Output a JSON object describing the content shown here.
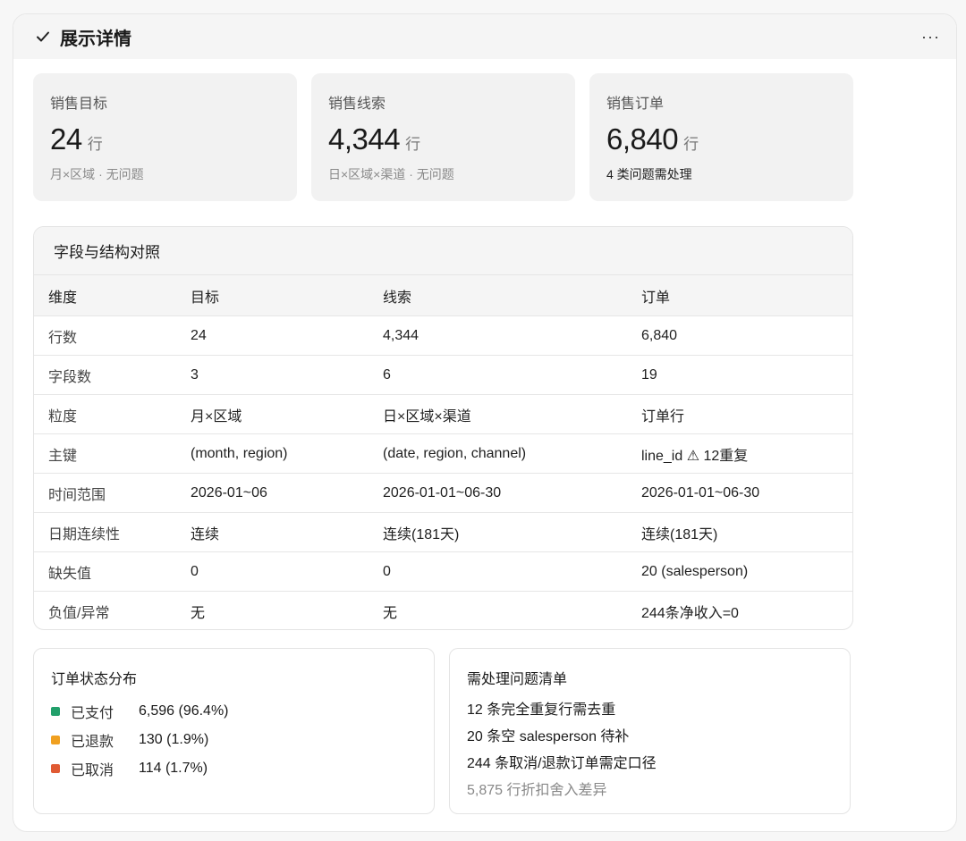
{
  "header": {
    "title": "展示详情",
    "check_icon": "check-icon",
    "more_icon": "more-horizontal-icon",
    "more_label": "···"
  },
  "cards": [
    {
      "label": "销售目标",
      "value": "24",
      "unit": "行",
      "note": "月×区域 · 无问题",
      "warn": false
    },
    {
      "label": "销售线索",
      "value": "4,344",
      "unit": "行",
      "note": "日×区域×渠道 · 无问题",
      "warn": false
    },
    {
      "label": "销售订单",
      "value": "6,840",
      "unit": "行",
      "note": "4 类问题需处理",
      "warn": true
    }
  ],
  "comparison": {
    "title": "字段与结构对照",
    "headers": [
      "维度",
      "目标",
      "线索",
      "订单"
    ],
    "rows": [
      [
        "行数",
        "24",
        "4,344",
        "6,840"
      ],
      [
        "字段数",
        "3",
        "6",
        "19"
      ],
      [
        "粒度",
        "月×区域",
        "日×区域×渠道",
        "订单行"
      ],
      [
        "主键",
        "(month, region)",
        "(date, region, channel)",
        "line_id ⚠ 12重复"
      ],
      [
        "时间范围",
        "2026-01~06",
        "2026-01-01~06-30",
        "2026-01-01~06-30"
      ],
      [
        "日期连续性",
        "连续",
        "连续(181天)",
        "连续(181天)"
      ],
      [
        "缺失值",
        "0",
        "0",
        "20 (salesperson)"
      ],
      [
        "负值/异常",
        "无",
        "无",
        "244条净收入=0"
      ]
    ]
  },
  "order_status": {
    "title": "订单状态分布",
    "items": [
      {
        "label": "已支付",
        "value": "6,596 (96.4%)",
        "color": "#22a06b"
      },
      {
        "label": "已退款",
        "value": "130 (1.9%)",
        "color": "#f0a020"
      },
      {
        "label": "已取消",
        "value": "114 (1.7%)",
        "color": "#e05a33"
      }
    ]
  },
  "issues": {
    "title": "需处理问题清单",
    "items": [
      {
        "text": "12 条完全重复行需去重",
        "muted": false
      },
      {
        "text": "20 条空 salesperson 待补",
        "muted": false
      },
      {
        "text": "244 条取消/退款订单需定口径",
        "muted": false
      },
      {
        "text": "5,875 行折扣舍入差异",
        "muted": true
      }
    ]
  }
}
